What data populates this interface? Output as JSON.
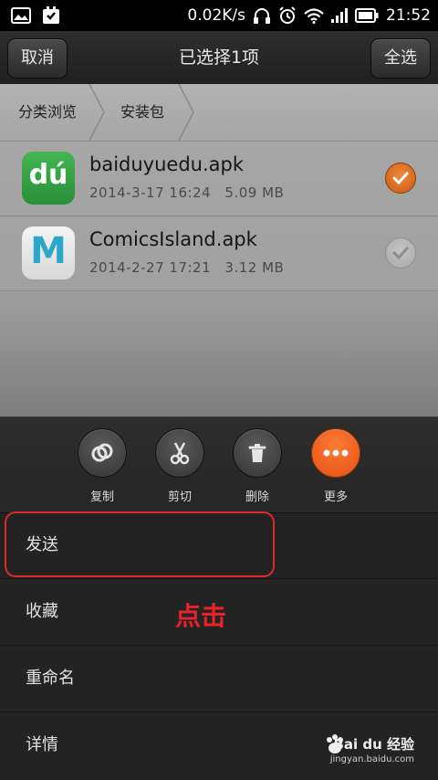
{
  "status_bar": {
    "network_speed": "0.02K/s",
    "time": "21:52"
  },
  "title_bar": {
    "cancel_label": "取消",
    "title": "已选择1项",
    "select_all_label": "全选"
  },
  "breadcrumb": {
    "items": [
      "分类浏览",
      "安装包"
    ]
  },
  "files": [
    {
      "name": "baiduyuedu.apk",
      "date": "2014-3-17 16:24",
      "size": "5.09 MB",
      "checked": true,
      "icon_text": "dú"
    },
    {
      "name": "ComicsIsland.apk",
      "date": "2014-2-27 17:21",
      "size": "3.12 MB",
      "checked": false,
      "icon_text": "M"
    }
  ],
  "actions": [
    {
      "label": "复制",
      "icon": "copy-icon"
    },
    {
      "label": "剪切",
      "icon": "scissors-icon"
    },
    {
      "label": "删除",
      "icon": "trash-icon"
    },
    {
      "label": "更多",
      "icon": "more-icon"
    }
  ],
  "menu": {
    "items": [
      "发送",
      "收藏",
      "重命名",
      "详情"
    ]
  },
  "annotation": {
    "text": "点击"
  },
  "watermark": {
    "brand": "Bai du 经验",
    "url": "jingyan.baidu.com"
  },
  "colors": {
    "accent_orange": "#e8641e",
    "annotation_red": "#e02a2a",
    "icon_green": "#34a34a",
    "icon_teal": "#2aa7c9"
  }
}
